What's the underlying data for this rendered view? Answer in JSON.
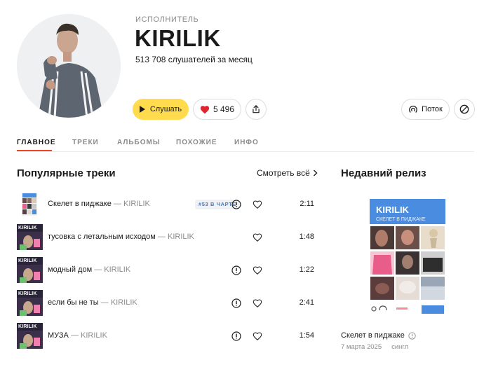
{
  "artist": {
    "kind": "ИСПОЛНИТЕЛЬ",
    "name": "KIRILIK",
    "listeners": "513 708 слушателей за месяц"
  },
  "actions": {
    "play_label": "Слушать",
    "likes": "5 496",
    "wave_label": "Поток"
  },
  "tabs": [
    "ГЛАВНОЕ",
    "ТРЕКИ",
    "АЛЬБОМЫ",
    "ПОХОЖИЕ",
    "ИНФО"
  ],
  "popular": {
    "title": "Популярные треки",
    "see_all": "Смотреть всё",
    "tracks": [
      {
        "title": "Скелет в пиджаке",
        "artist": "KIRILIK",
        "badge": "#53 В ЧАРТЕ",
        "explicit": true,
        "duration": "2:11"
      },
      {
        "title": "тусовка с летальным исходом",
        "artist": "KIRILIK",
        "badge": "",
        "explicit": false,
        "duration": "1:48"
      },
      {
        "title": "модный дом",
        "artist": "KIRILIK",
        "badge": "",
        "explicit": true,
        "duration": "1:22"
      },
      {
        "title": "если бы не ты",
        "artist": "KIRILIK",
        "badge": "",
        "explicit": true,
        "duration": "2:41"
      },
      {
        "title": "МУЗА",
        "artist": "KIRILIK",
        "badge": "",
        "explicit": true,
        "duration": "1:54"
      }
    ],
    "cover_text": "KIRILIK"
  },
  "recent": {
    "title": "Недавний релиз",
    "cover_artist": "KIRILIK",
    "cover_subtitle": "СКЕЛЕТ В ПИДЖАКЕ",
    "name": "Скелет в пиджаке",
    "date": "7 марта 2025",
    "type": "сингл"
  },
  "colors": {
    "accent_yellow": "#ffdb4d",
    "heart_red": "#e0262d",
    "tab_underline": "#e8472a",
    "badge_blue": "#4b76b8",
    "release_blue": "#4a8de0"
  }
}
